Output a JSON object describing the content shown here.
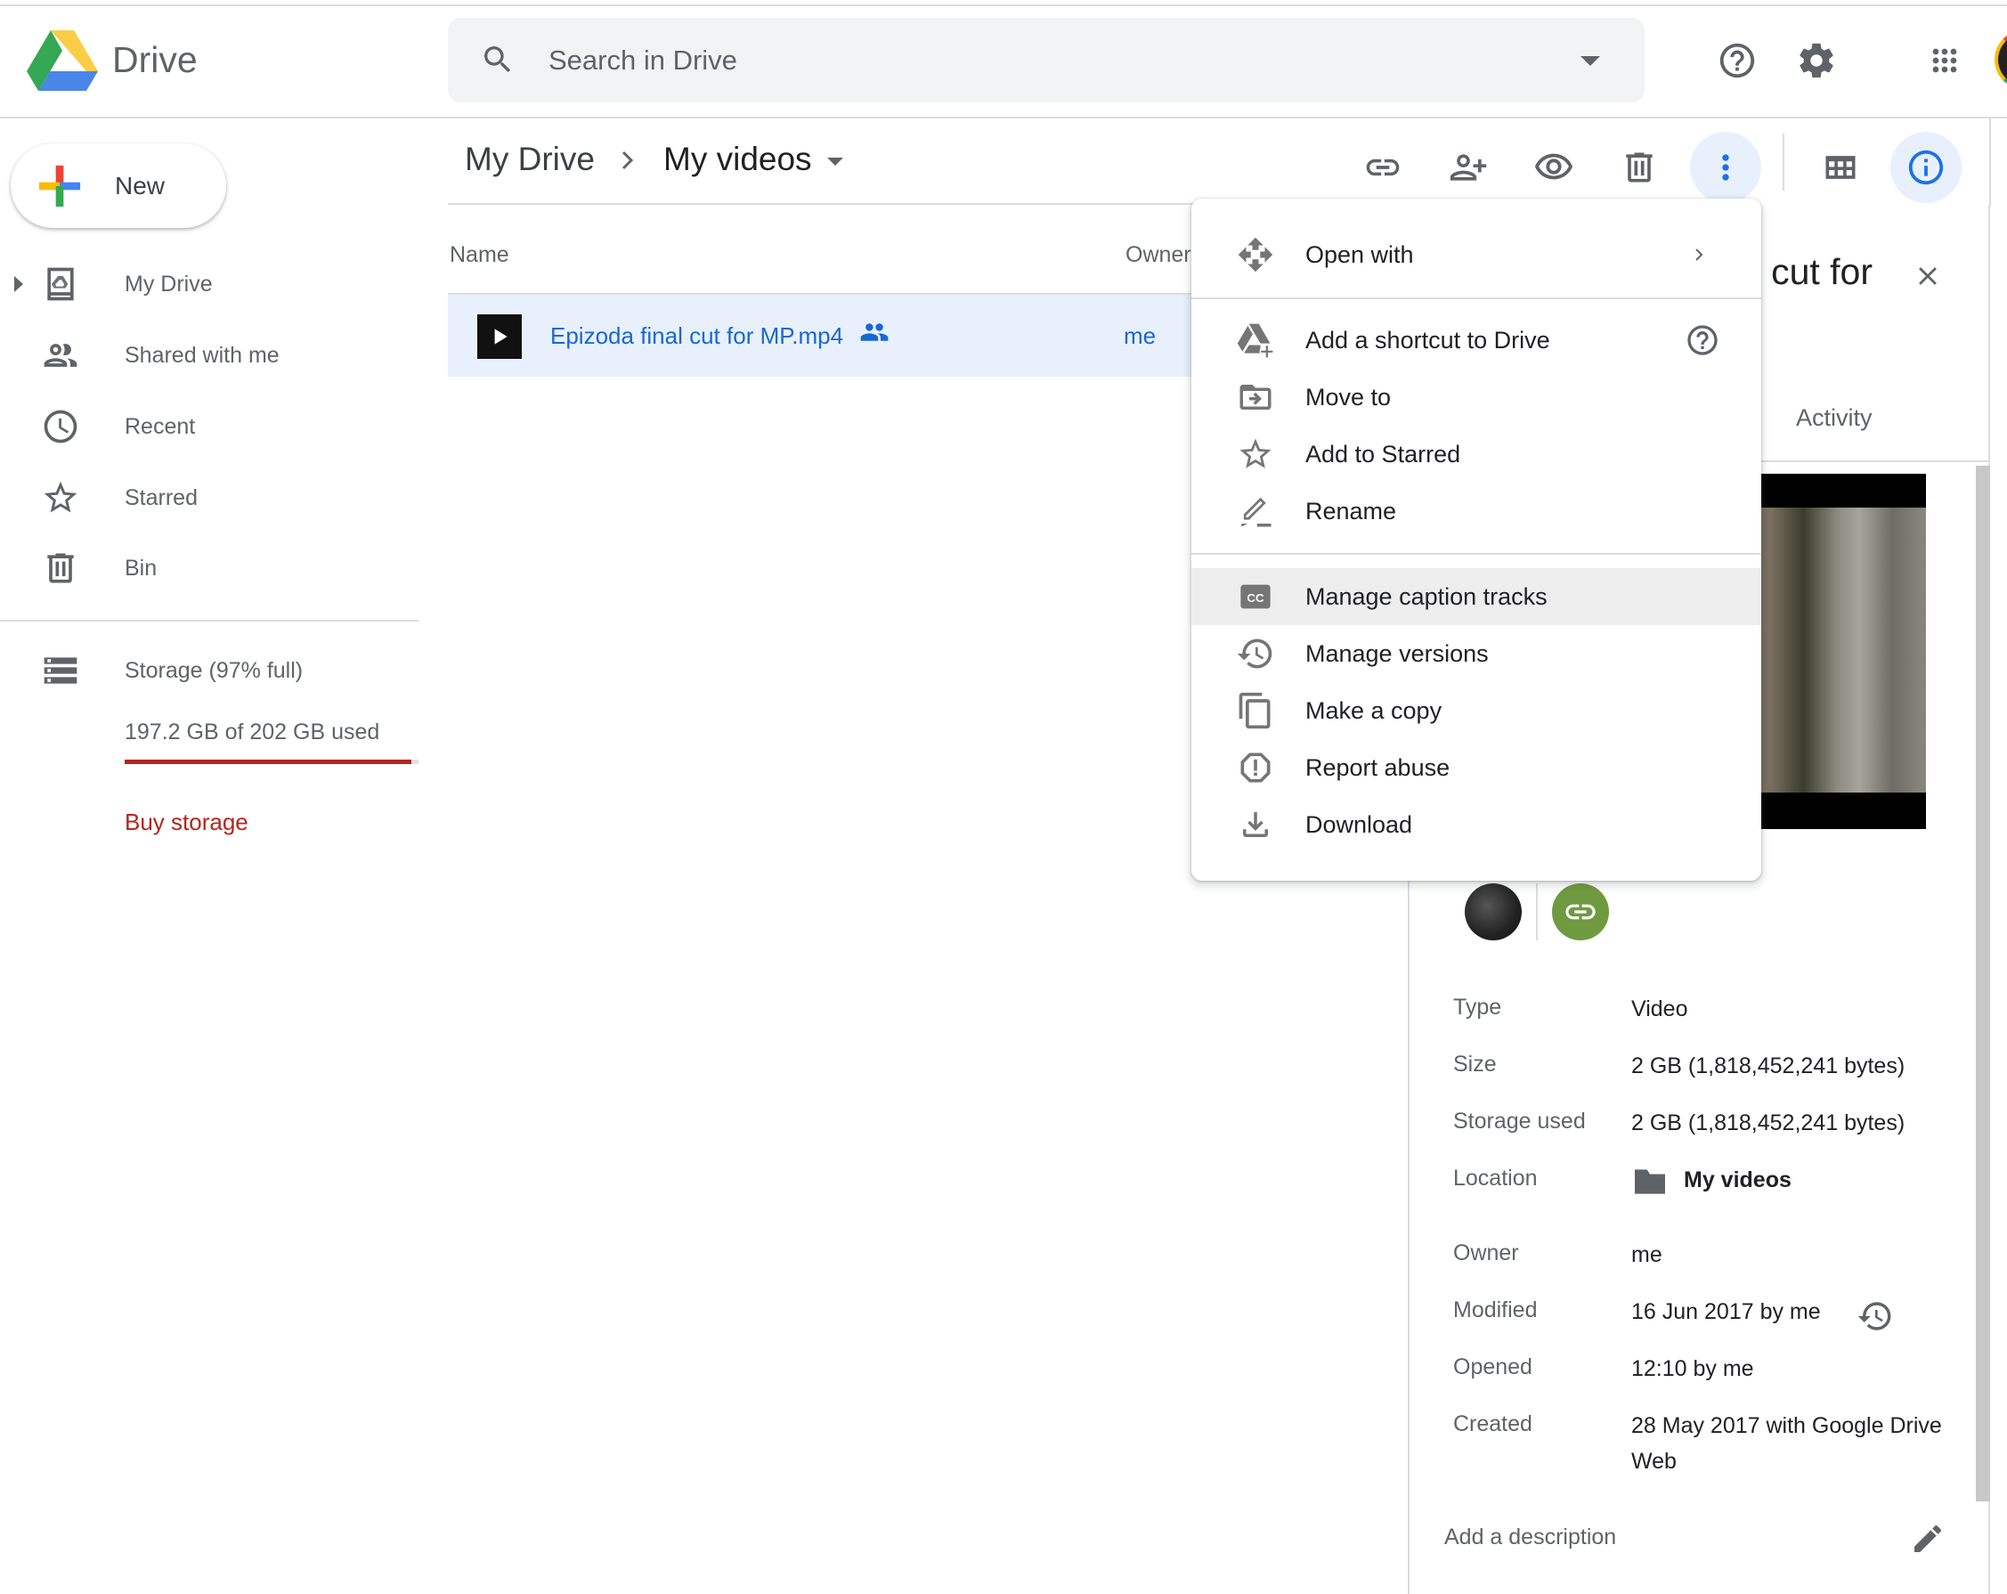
{
  "app": {
    "name": "Drive"
  },
  "search": {
    "placeholder": "Search in Drive"
  },
  "header_icons": [
    "help-icon",
    "settings-icon",
    "apps-icon",
    "account-avatar"
  ],
  "sidebar": {
    "new_label": "New",
    "items": [
      {
        "label": "My Drive",
        "icon": "my-drive-icon",
        "expandable": true
      },
      {
        "label": "Shared with me",
        "icon": "shared-icon"
      },
      {
        "label": "Recent",
        "icon": "clock-icon"
      },
      {
        "label": "Starred",
        "icon": "star-icon"
      },
      {
        "label": "Bin",
        "icon": "trash-icon"
      }
    ],
    "storage": {
      "label": "Storage (97% full)",
      "used_text": "197.2 GB of 202 GB used",
      "used_fraction": 0.976,
      "bar_color": "#b3261e",
      "buy_label": "Buy storage"
    }
  },
  "breadcrumb": {
    "root": "My Drive",
    "current": "My videos"
  },
  "toolbar": {
    "icons": [
      "get-link-icon",
      "share-icon",
      "preview-icon",
      "remove-icon",
      "more-actions-icon",
      "grid-view-icon",
      "view-details-icon"
    ]
  },
  "file_list": {
    "columns": [
      "Name",
      "Owner"
    ],
    "rows": [
      {
        "name": "Epizoda final cut for MP.mp4",
        "shared": true,
        "owner": "me",
        "selected": true
      }
    ]
  },
  "context_menu": {
    "items": [
      {
        "label": "Open with",
        "icon": "open-with-icon",
        "submenu": true
      },
      {
        "label": "Add a shortcut to Drive",
        "icon": "add-shortcut-icon",
        "help": true
      },
      {
        "label": "Move to",
        "icon": "move-to-icon"
      },
      {
        "label": "Add to Starred",
        "icon": "star-icon"
      },
      {
        "label": "Rename",
        "icon": "rename-icon"
      },
      {
        "label": "Manage caption tracks",
        "icon": "captions-icon",
        "highlighted": true
      },
      {
        "label": "Manage versions",
        "icon": "versions-icon"
      },
      {
        "label": "Make a copy",
        "icon": "copy-icon"
      },
      {
        "label": "Report abuse",
        "icon": "report-icon"
      },
      {
        "label": "Download",
        "icon": "download-icon"
      }
    ]
  },
  "details": {
    "title": "Epizoda final cut for",
    "tab": "Activity",
    "properties": [
      {
        "label": "Type",
        "value": "Video"
      },
      {
        "label": "Size",
        "value": "2 GB (1,818,452,241 bytes)"
      },
      {
        "label": "Storage used",
        "value": "2 GB (1,818,452,241 bytes)"
      },
      {
        "label": "Location",
        "value": "My videos"
      },
      {
        "label": "Owner",
        "value": "me"
      },
      {
        "label": "Modified",
        "value": "16 Jun 2017 by me"
      },
      {
        "label": "Opened",
        "value": "12:10 by me"
      },
      {
        "label": "Created",
        "value": "28 May 2017 with Google Drive Web"
      }
    ],
    "description_placeholder": "Add a description"
  },
  "colors": {
    "accent": "#1a73e8",
    "link_text": "#1967d2",
    "selected_row": "#e8f0fe",
    "link_share_avatar": "#6f9a40"
  }
}
